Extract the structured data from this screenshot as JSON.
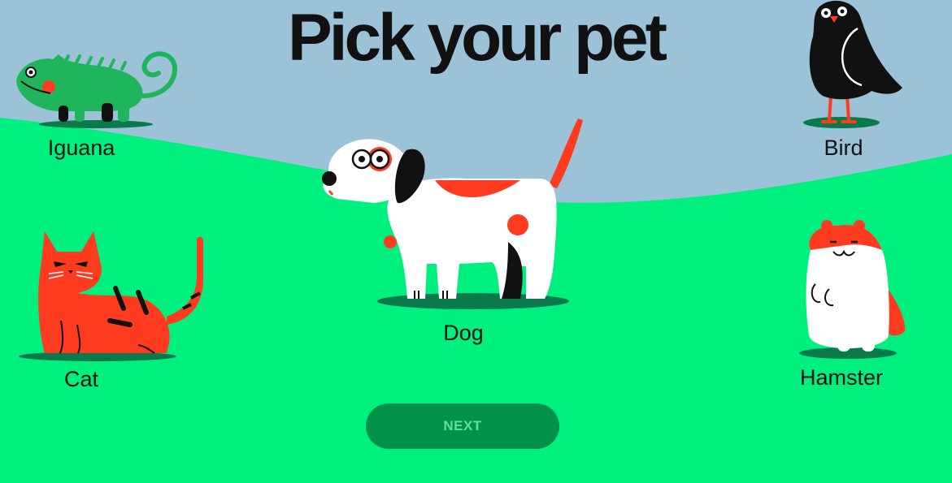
{
  "page": {
    "title": "Pick your pet",
    "colors": {
      "sky": "#9bc2d6",
      "grass": "#00f07f",
      "shadow": "#0a7a4c",
      "button": "#019249",
      "button_text": "#5fe0a0",
      "accent_red": "#ff3b1f"
    }
  },
  "pets": {
    "iguana": {
      "label": "Iguana",
      "icon": "iguana-icon"
    },
    "bird": {
      "label": "Bird",
      "icon": "bird-icon"
    },
    "dog": {
      "label": "Dog",
      "icon": "dog-icon"
    },
    "cat": {
      "label": "Cat",
      "icon": "cat-icon"
    },
    "hamster": {
      "label": "Hamster",
      "icon": "hamster-icon"
    }
  },
  "next_button": {
    "label": "NEXT"
  }
}
